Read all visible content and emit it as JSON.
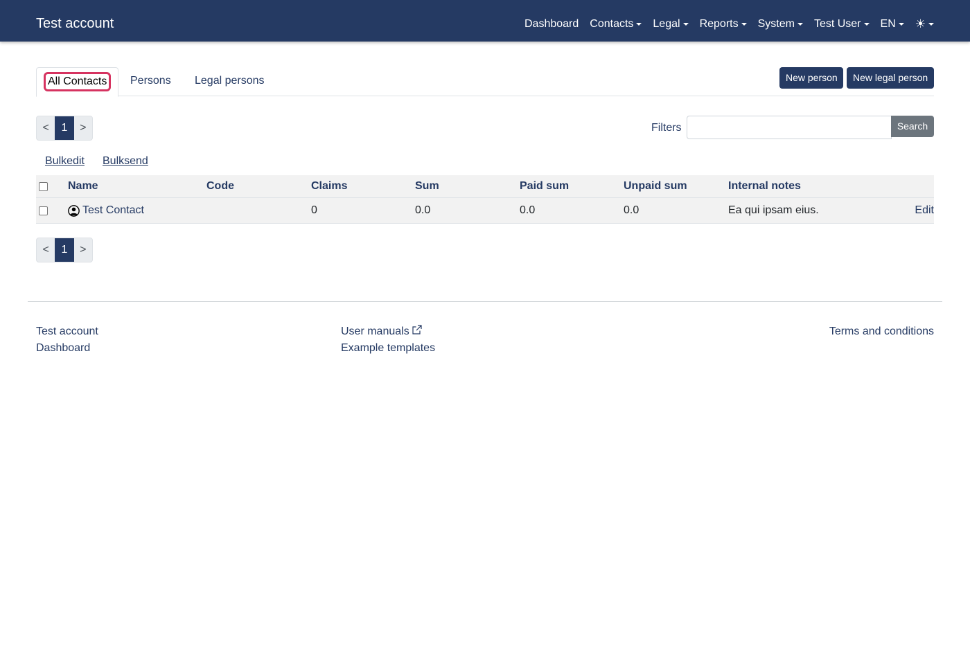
{
  "navbar": {
    "brand": "Test account",
    "items": [
      {
        "label": "Dashboard"
      },
      {
        "label": "Contacts"
      },
      {
        "label": "Legal"
      },
      {
        "label": "Reports"
      },
      {
        "label": "System"
      },
      {
        "label": "Test User"
      },
      {
        "label": "EN"
      },
      {
        "label": "☀"
      }
    ]
  },
  "tabs": [
    {
      "label": "All Contacts",
      "active": true
    },
    {
      "label": "Persons"
    },
    {
      "label": "Legal persons"
    }
  ],
  "actions": {
    "new_person": "New person",
    "new_legal_person": "New legal person"
  },
  "pagination": {
    "prev": "<",
    "current": "1",
    "next": ">"
  },
  "filters": {
    "label": "Filters",
    "value": "",
    "search_button": "Search"
  },
  "bulk": {
    "edit": "Bulkedit",
    "send": "Bulksend"
  },
  "table": {
    "headers": {
      "name": "Name",
      "code": "Code",
      "claims": "Claims",
      "sum": "Sum",
      "paid_sum": "Paid sum",
      "unpaid_sum": "Unpaid sum",
      "internal_notes": "Internal notes"
    },
    "rows": [
      {
        "name": "Test Contact",
        "code": "",
        "claims": "0",
        "sum": "0.0",
        "paid_sum": "0.0",
        "unpaid_sum": "0.0",
        "internal_notes": "Ea qui ipsam eius.",
        "edit": "Edit"
      }
    ]
  },
  "footer": {
    "col1": [
      "Test account",
      "Dashboard"
    ],
    "col2": [
      "User manuals",
      "Example templates"
    ],
    "col3": [
      "Terms and conditions"
    ]
  },
  "colors": {
    "primary": "#253a63",
    "focus_ring": "#d63360",
    "secondary": "#6c757d"
  }
}
